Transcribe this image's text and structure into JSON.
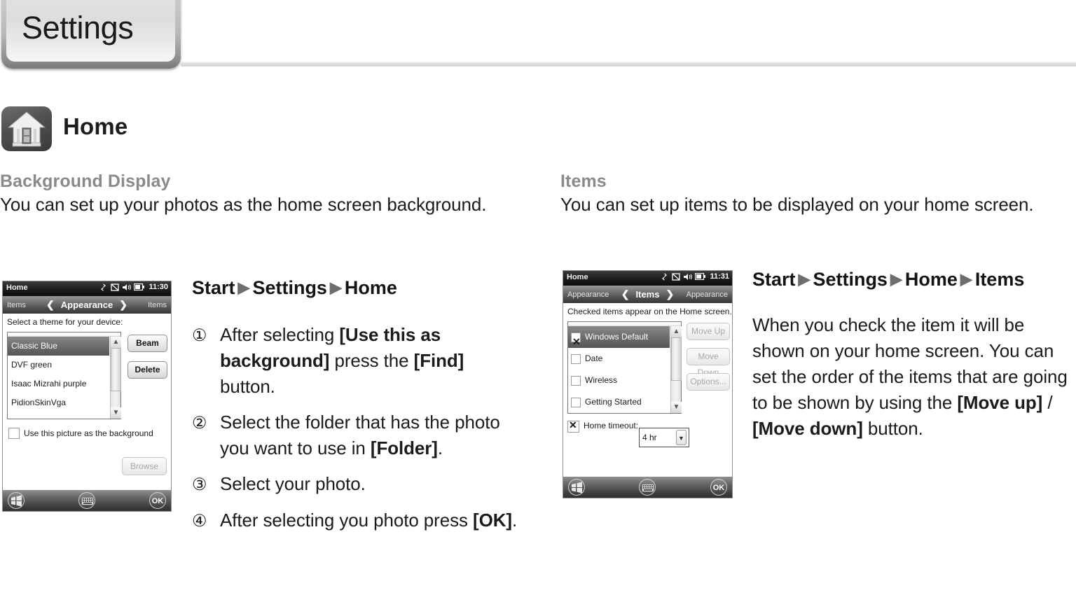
{
  "header": {
    "tab_label": "Settings"
  },
  "section": {
    "icon": "home-icon",
    "title": "Home"
  },
  "left_column": {
    "sub_head": "Background Display",
    "sub_body": "You can set up your photos as the home screen background.",
    "path": [
      "Start",
      "Settings",
      "Home"
    ],
    "steps": [
      {
        "num": "①",
        "html": "After selecting <b>[Use this as background]</b> press the <b>[Find]</b> button."
      },
      {
        "num": "②",
        "html": "Select the folder that has the photo you want to use in <b>[Folder]</b>."
      },
      {
        "num": "③",
        "html": "Select your photo."
      },
      {
        "num": "④",
        "html": "After selecting you photo press <b>[OK]</b>."
      }
    ]
  },
  "right_column": {
    "sub_head": "Items",
    "sub_body": "You can set up items to be displayed on your home screen.",
    "path": [
      "Start",
      "Settings",
      "Home",
      "Items"
    ],
    "paragraph_html": "When you check the item it will be shown on your home screen. You can set the order of the items that are going to be shown by using the <b>[Move up]</b> / <b>[Move down]</b> button."
  },
  "device_left": {
    "status": {
      "title": "Home",
      "time": "11:30",
      "icons": [
        "connectivity-icon",
        "sync-icon",
        "volume-icon",
        "battery-icon"
      ]
    },
    "nav": {
      "left": "Items",
      "center": "Appearance",
      "right": "Items",
      "back_arrow": "❮",
      "forward_arrow": "❯"
    },
    "hint": "Select a theme for your device:",
    "list_items": [
      {
        "label": "Classic Blue",
        "selected": true
      },
      {
        "label": "DVF green",
        "selected": false
      },
      {
        "label": "Isaac Mizrahi purple",
        "selected": false
      },
      {
        "label": "PidionSkinVga",
        "selected": false
      }
    ],
    "buttons": {
      "beam": "Beam",
      "delete": "Delete",
      "browse": "Browse"
    },
    "checkbox": {
      "label": "Use this picture as the background",
      "checked": false
    },
    "taskbar": {
      "start": "start-icon",
      "keyboard": "keyboard-icon",
      "ok": "OK"
    }
  },
  "device_right": {
    "status": {
      "title": "Home",
      "time": "11:31",
      "icons": [
        "connectivity-icon",
        "sync-icon",
        "volume-icon",
        "battery-icon"
      ]
    },
    "nav": {
      "left": "Appearance",
      "center": "Items",
      "right": "Appearance",
      "back_arrow": "❮",
      "forward_arrow": "❯"
    },
    "hint": "Checked items appear on the Home screen.",
    "list_items": [
      {
        "label": "Windows Default",
        "checked": true,
        "selected": true
      },
      {
        "label": "Date",
        "checked": false,
        "selected": false
      },
      {
        "label": "Wireless",
        "checked": false,
        "selected": false
      },
      {
        "label": "Getting Started",
        "checked": false,
        "selected": false
      }
    ],
    "buttons": {
      "move_up": "Move Up",
      "move_down": "Move Down",
      "options": "Options..."
    },
    "timeout": {
      "label": "Home timeout:",
      "checked": true,
      "value": "4 hr"
    },
    "taskbar": {
      "start": "start-icon",
      "keyboard": "keyboard-icon",
      "ok": "OK"
    }
  },
  "colors": {
    "sub_head": "#8a8a8a",
    "body_text": "#1b1b1b",
    "tab_bg": "#dddddd",
    "rule": "#dcdcdc"
  }
}
